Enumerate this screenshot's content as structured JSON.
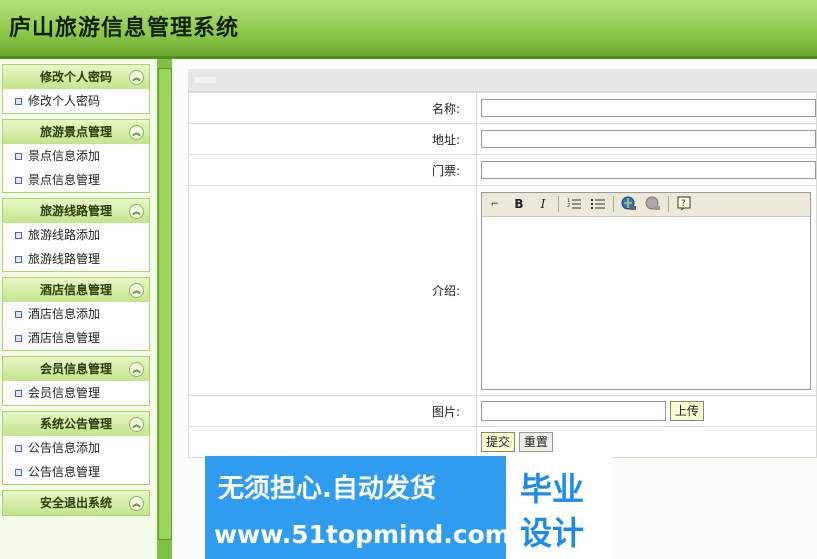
{
  "app": {
    "title": "庐山旅游信息管理系统"
  },
  "sidebar": {
    "groups": [
      {
        "title": "修改个人密码",
        "items": [
          "修改个人密码"
        ]
      },
      {
        "title": "旅游景点管理",
        "items": [
          "景点信息添加",
          "景点信息管理"
        ]
      },
      {
        "title": "旅游线路管理",
        "items": [
          "旅游线路添加",
          "旅游线路管理"
        ]
      },
      {
        "title": "酒店信息管理",
        "items": [
          "酒店信息添加",
          "酒店信息管理"
        ]
      },
      {
        "title": "会员信息管理",
        "items": [
          "会员信息管理"
        ]
      },
      {
        "title": "系统公告管理",
        "items": [
          "公告信息添加",
          "公告信息管理"
        ]
      },
      {
        "title": "安全退出系统",
        "items": []
      }
    ]
  },
  "form": {
    "name_label": "名称:",
    "name_value": "",
    "address_label": "地址:",
    "address_value": "",
    "ticket_label": "门票:",
    "ticket_value": "",
    "intro_label": "介绍:",
    "editor_toolbar": [
      "bold-icon",
      "italic-icon",
      "ordered-list-icon",
      "unordered-list-icon",
      "link-icon",
      "unlink-icon",
      "help-icon"
    ],
    "editor_bold": "B",
    "editor_italic": "I",
    "image_label": "图片:",
    "image_value": "",
    "upload_button": "上传",
    "submit_button": "提交",
    "reset_button": "重置"
  },
  "watermark": {
    "line1": "无须担心.自动发货",
    "line2": "www.51topmind.com",
    "badge_line1": "毕业",
    "badge_line2": "设计"
  },
  "colors": {
    "header": "#8cc84a",
    "sidebar_border": "#a9d36b",
    "banner": "#2f9cef"
  }
}
